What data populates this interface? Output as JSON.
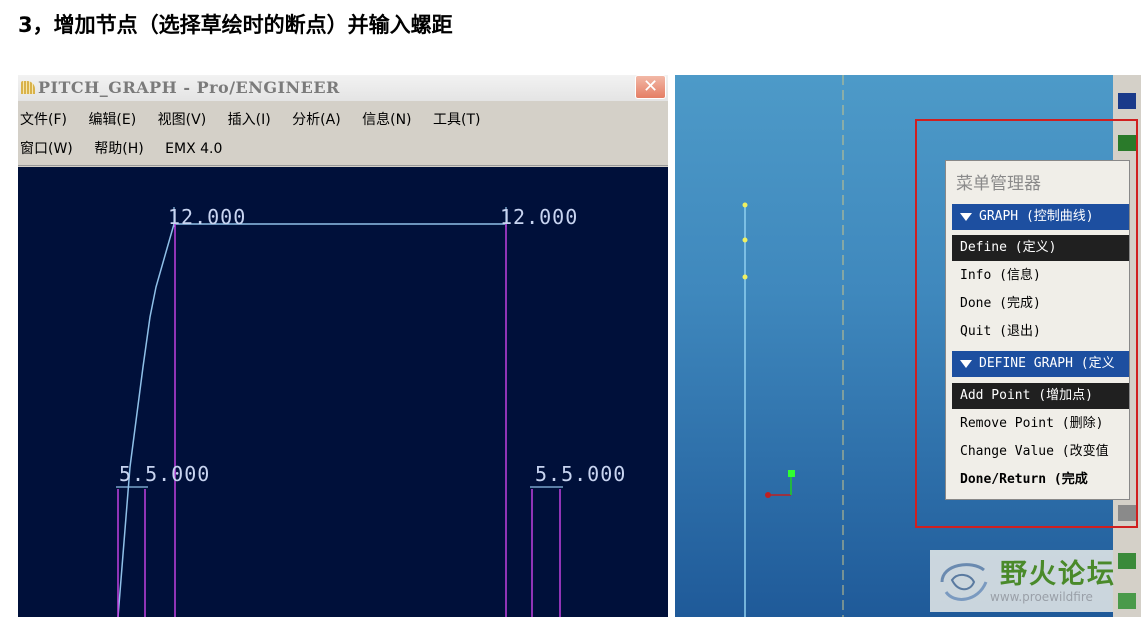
{
  "heading": "3，增加节点（选择草绘时的断点）并输入螺距",
  "window": {
    "title": "PITCH_GRAPH - Pro/ENGINEER",
    "close_glyph": "✕",
    "menu_row1": [
      "文件(F)",
      "编辑(E)",
      "视图(V)",
      "插入(I)",
      "分析(A)",
      "信息(N)",
      "工具(T)"
    ],
    "menu_row2": [
      "窗口(W)",
      "帮助(H)",
      "EMX 4.0"
    ]
  },
  "graph": {
    "labels": {
      "top_left": "12.000",
      "top_right": "12.000",
      "mid_left": "5.5.000",
      "mid_right": "5.5.000"
    }
  },
  "menu_manager": {
    "title": "菜单管理器",
    "graph_header": "GRAPH (控制曲线)",
    "graph_items": [
      "Define (定义)",
      "Info (信息)",
      "Done (完成)",
      "Quit (退出)"
    ],
    "define_header": "DEFINE GRAPH (定义",
    "define_items": [
      "Add Point (增加点)",
      "Remove Point (删除)",
      "Change Value (改变值",
      "Done/Return (完成"
    ]
  },
  "watermark": {
    "name": "野火论坛",
    "url": "www.proewildfire"
  },
  "colors": {
    "graph_bg": "#00103a",
    "curve": "#8fc0e8",
    "magenta": "#c040e0",
    "highlight_box": "#d01f1f",
    "menu_header": "#1d4fa0"
  }
}
